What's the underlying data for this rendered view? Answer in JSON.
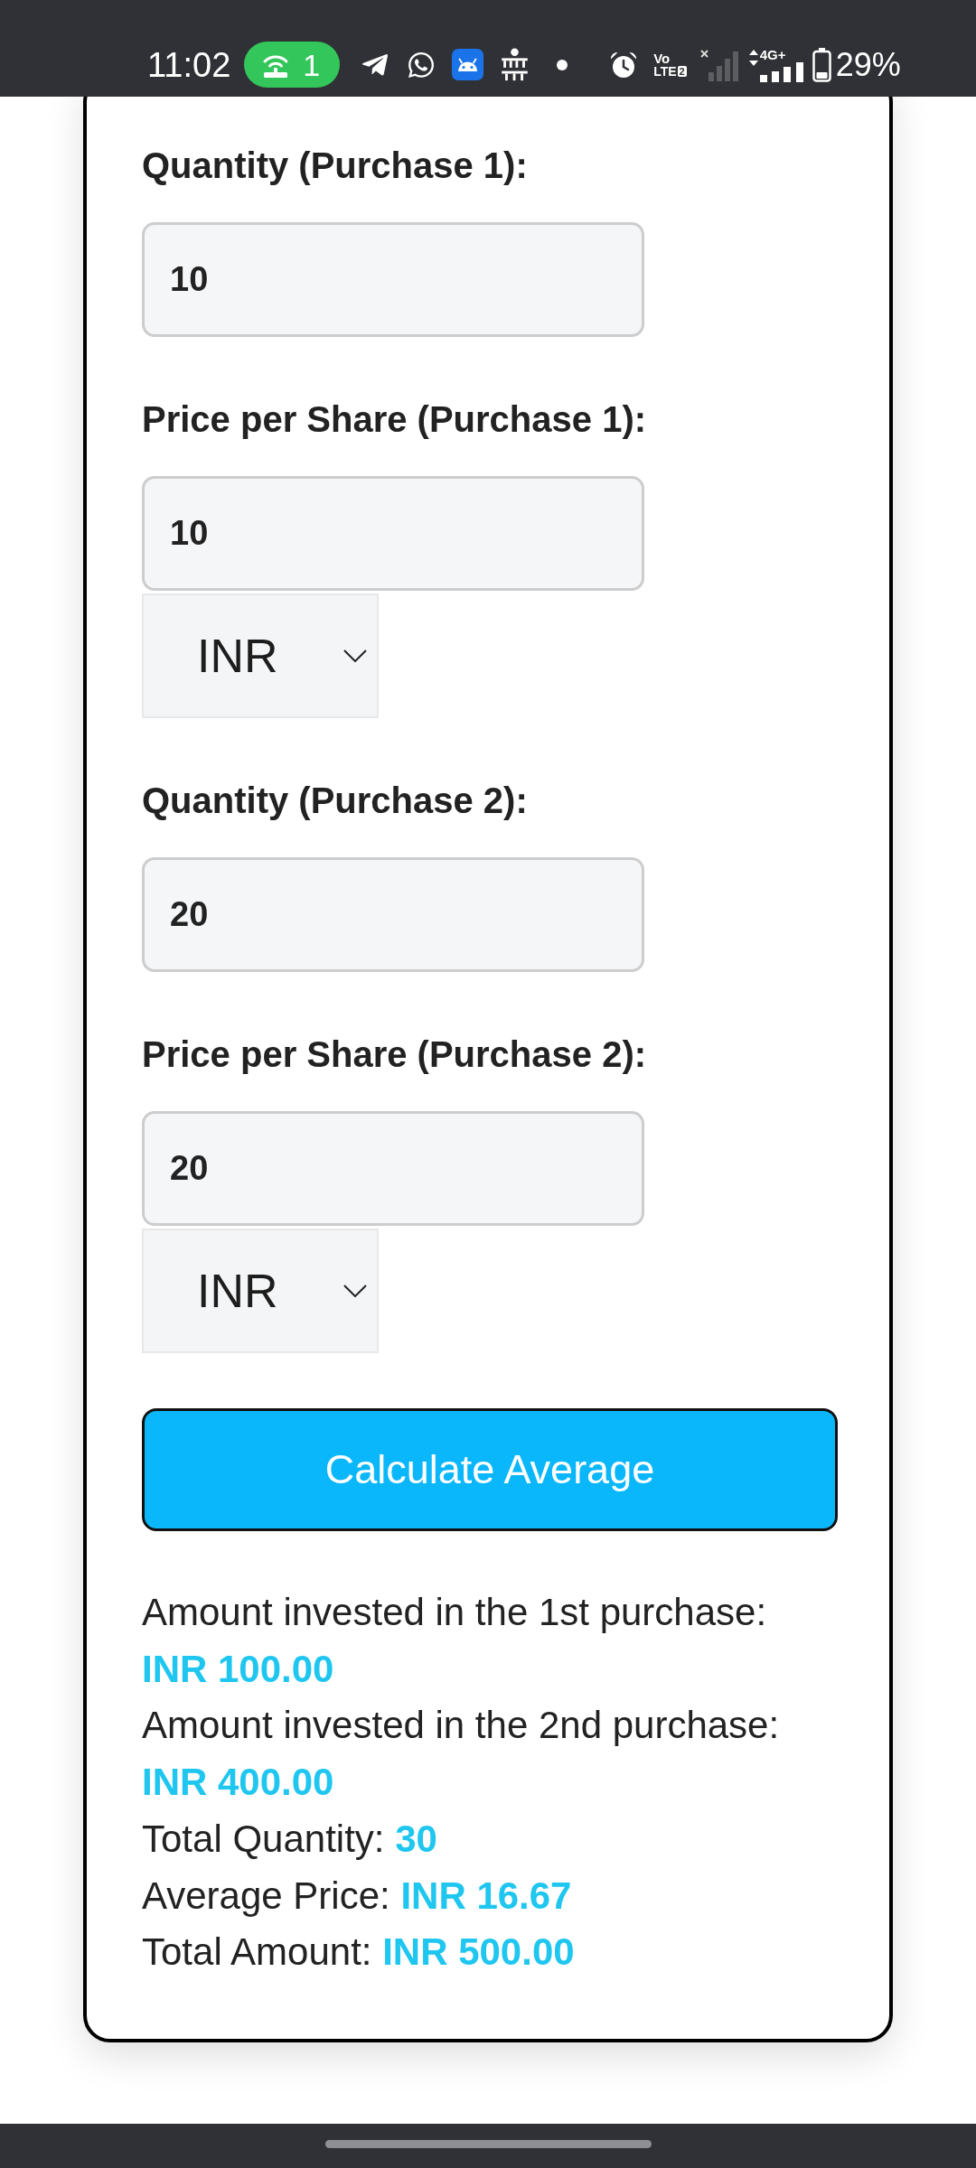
{
  "status_bar": {
    "time": "11:02",
    "hotspot_count": "1",
    "volte": {
      "top": "Vo",
      "bottom": "LTE",
      "sim": "2"
    },
    "network_type": "4G+",
    "battery_percent": "29%"
  },
  "form": {
    "fields": [
      {
        "kind": "quantity",
        "label": "Quantity (Purchase 1):",
        "value": "10"
      },
      {
        "kind": "price",
        "label": "Price per Share (Purchase 1):",
        "value": "10",
        "currency": "INR"
      },
      {
        "kind": "quantity",
        "label": "Quantity (Purchase 2):",
        "value": "20"
      },
      {
        "kind": "price",
        "label": "Price per Share (Purchase 2):",
        "value": "20",
        "currency": "INR"
      }
    ]
  },
  "calculate_button": {
    "label": "Calculate Average"
  },
  "results": [
    {
      "label": "Amount invested in the 1st purchase:",
      "value": "INR 100.00"
    },
    {
      "label": "Amount invested in the 2nd purchase:",
      "value": "INR 400.00"
    },
    {
      "label": "Total Quantity:",
      "value": "30"
    },
    {
      "label": "Average Price:",
      "value": "INR 16.67"
    },
    {
      "label": "Total Amount:",
      "value": "INR 500.00"
    }
  ]
}
